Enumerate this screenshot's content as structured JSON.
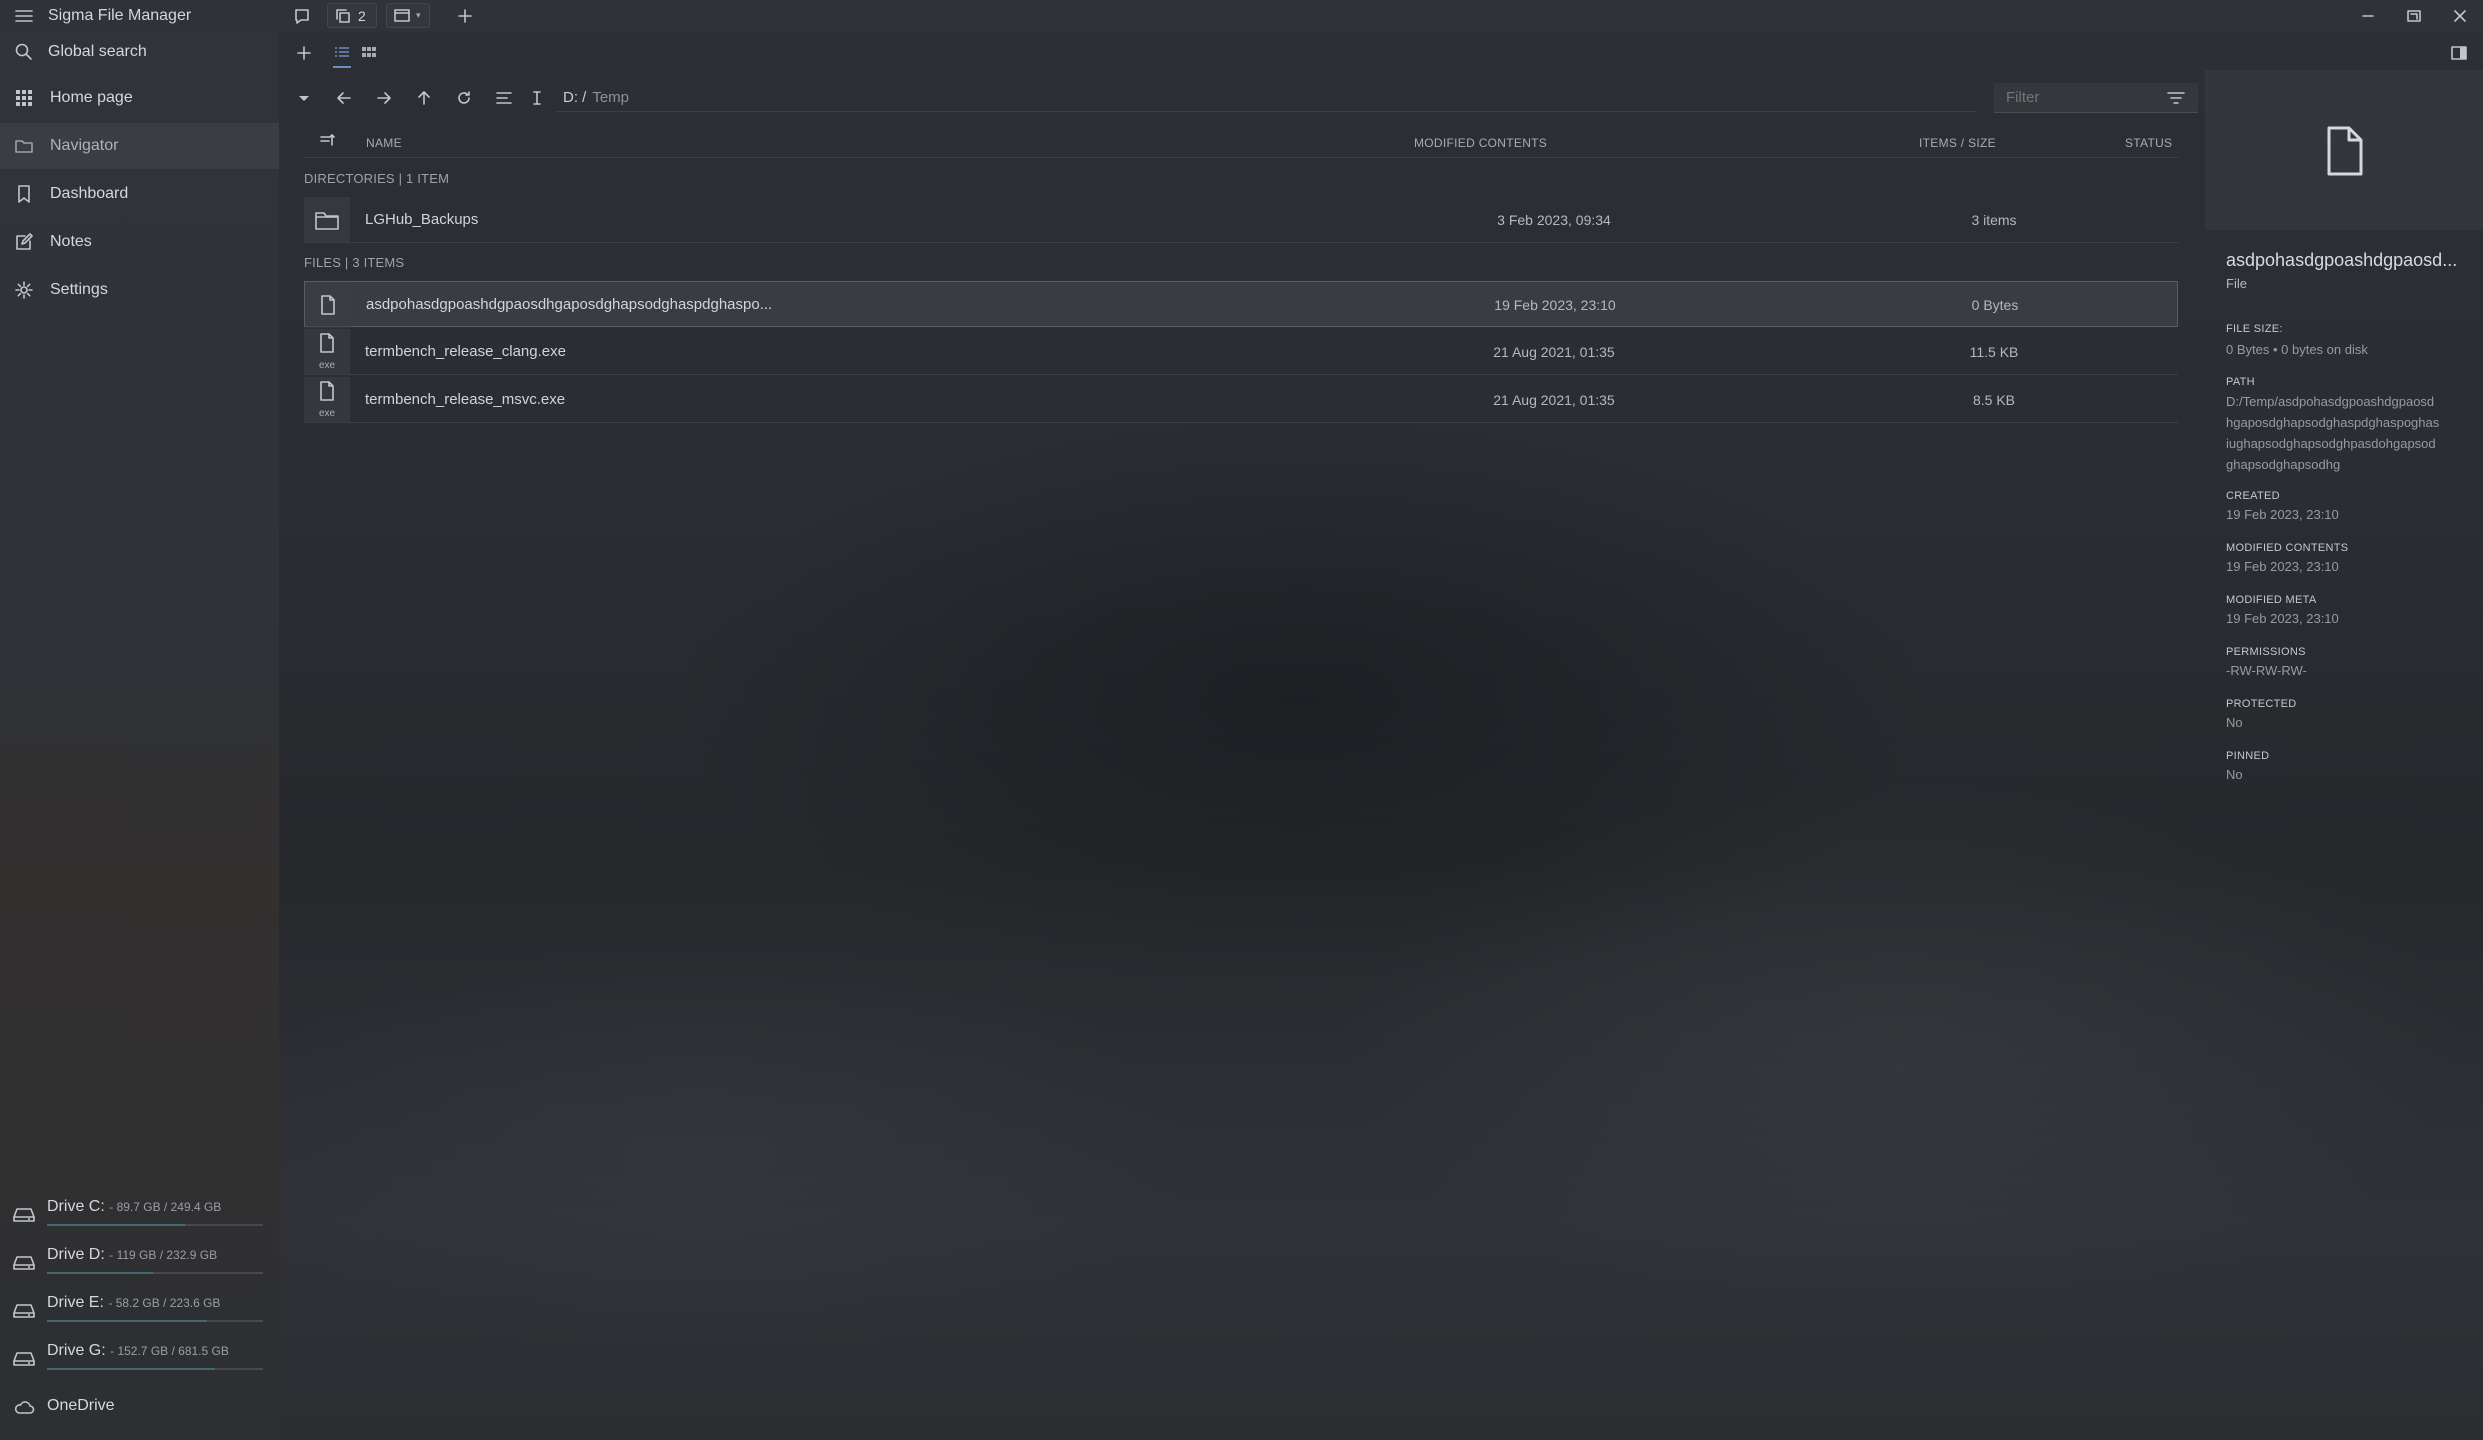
{
  "app": {
    "title": "Sigma File Manager",
    "tabs_count": "2",
    "new_tab": "+"
  },
  "sidebar": {
    "search_label": "Global search",
    "items": [
      {
        "label": "Home page",
        "icon": "grid-icon"
      },
      {
        "label": "Navigator",
        "icon": "folder-icon"
      },
      {
        "label": "Dashboard",
        "icon": "bookmark-icon"
      },
      {
        "label": "Notes",
        "icon": "edit-icon"
      },
      {
        "label": "Settings",
        "icon": "gear-icon"
      }
    ],
    "drives": [
      {
        "name": "Drive C:",
        "size": "- 89.7 GB / 249.4 GB",
        "used_fraction": 0.64
      },
      {
        "name": "Drive D:",
        "size": "- 119 GB / 232.9 GB",
        "used_fraction": 0.49
      },
      {
        "name": "Drive E:",
        "size": "- 58.2 GB / 223.6 GB",
        "used_fraction": 0.74
      },
      {
        "name": "Drive G:",
        "size": "- 152.7 GB / 681.5 GB",
        "used_fraction": 0.78
      }
    ],
    "onedrive": "OneDrive"
  },
  "toolbar": {
    "path_drive": "D: /",
    "path_folder": "Temp",
    "filter_placeholder": "Filter"
  },
  "table": {
    "headers": {
      "name": "NAME",
      "modified": "MODIFIED CONTENTS",
      "items_size": "ITEMS / SIZE",
      "status": "STATUS"
    },
    "dirs_label": "DIRECTORIES | 1 ITEM",
    "files_label": "FILES | 3 ITEMS",
    "directories": [
      {
        "name": "LGHub_Backups",
        "modified": "3 Feb 2023, 09:34",
        "size": "3 items"
      }
    ],
    "files": [
      {
        "name": "asdpohasdgpoashdgpaosdhgaposdghapsodghaspdghaspo...",
        "modified": "19 Feb 2023, 23:10",
        "size": "0 Bytes",
        "ext": ""
      },
      {
        "name": "termbench_release_clang.exe",
        "modified": "21 Aug 2021, 01:35",
        "size": "11.5 KB",
        "ext": "exe"
      },
      {
        "name": "termbench_release_msvc.exe",
        "modified": "21 Aug 2021, 01:35",
        "size": "8.5 KB",
        "ext": "exe"
      }
    ]
  },
  "info": {
    "title": "asdpohasdgpoashdgpaosd...",
    "type": "File",
    "file_size_label": "FILE SIZE:",
    "file_size": "0 Bytes • 0 bytes on disk",
    "path_label": "PATH",
    "path_lines": [
      "D:/Temp/asdpohasdgpoashdgpaosd",
      "hgaposdghapsodghaspdghaspoghas",
      "iughapsodghapsodghpasdohgapsod",
      "ghapsodghapsodhg"
    ],
    "created_label": "CREATED",
    "created": "19 Feb 2023, 23:10",
    "modified_label": "MODIFIED CONTENTS",
    "modified": "19 Feb 2023, 23:10",
    "meta_label": "MODIFIED META",
    "meta": "19 Feb 2023, 23:10",
    "permissions_label": "PERMISSIONS",
    "permissions": "-RW-RW-RW-",
    "protected_label": "PROTECTED",
    "protected": "No",
    "pinned_label": "PINNED",
    "pinned": "No"
  },
  "colors": {
    "accent": "#3f6a6e",
    "background": "#2b2e33",
    "sidebar": "#303338"
  }
}
